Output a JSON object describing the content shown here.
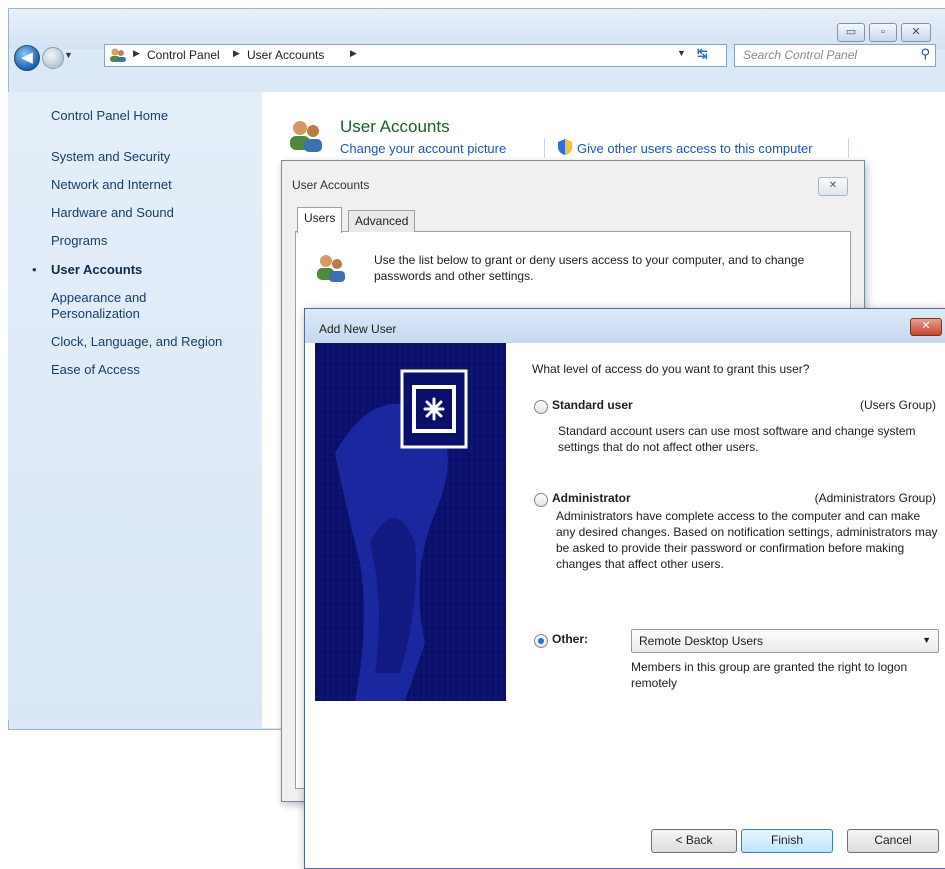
{
  "window": {
    "caption_buttons": {
      "minimize": "▭",
      "maximize": "▫",
      "close": "✕"
    }
  },
  "nav": {
    "breadcrumbs": [
      "Control Panel",
      "User Accounts"
    ],
    "search_placeholder": "Search Control Panel"
  },
  "sidebar": {
    "items": [
      {
        "label": "Control Panel Home"
      },
      {
        "label": "System and Security"
      },
      {
        "label": "Network and Internet"
      },
      {
        "label": "Hardware and Sound"
      },
      {
        "label": "Programs"
      },
      {
        "label": "User Accounts",
        "active": true
      },
      {
        "label": "Appearance and Personalization"
      },
      {
        "label": "Clock, Language, and Region"
      },
      {
        "label": "Ease of Access"
      }
    ]
  },
  "main": {
    "title": "User Accounts",
    "links": [
      "Change your account picture",
      "Give other users access to this computer"
    ]
  },
  "ua_dialog": {
    "title": "User Accounts",
    "tabs": [
      "Users",
      "Advanced"
    ],
    "description": "Use the list below to grant or deny users access to your computer, and to change passwords and other settings."
  },
  "add_user_dialog": {
    "title": "Add New User",
    "question": "What level of access do you want to grant this user?",
    "options": [
      {
        "label": "Standard user",
        "group": "(Users Group)",
        "description": "Standard account users can use most software and change system settings that do not affect other users."
      },
      {
        "label": "Administrator",
        "group": "(Administrators Group)",
        "description": "Administrators have complete access to the computer and can make any desired changes. Based on notification settings, administrators may be asked to provide their password or confirmation before making changes that affect other users."
      },
      {
        "label": "Other:",
        "selected": true,
        "select_value": "Remote Desktop Users",
        "description": "Members in this group are granted the right to logon remotely"
      }
    ],
    "buttons": {
      "back": "< Back",
      "finish": "Finish",
      "cancel": "Cancel"
    }
  },
  "colors": {
    "link": "#1a58b8",
    "title_green": "#1e5c2a",
    "banner_bg": "#0a0f6b"
  }
}
